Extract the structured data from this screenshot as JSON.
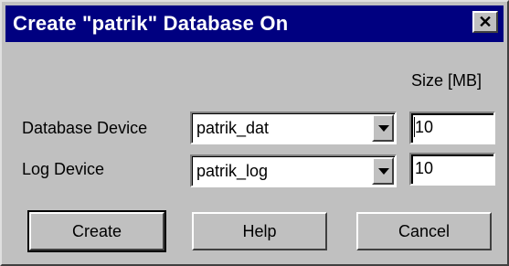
{
  "window": {
    "title": "Create \"patrik\" Database On",
    "close_glyph": "✕"
  },
  "size_header": "Size [MB]",
  "rows": [
    {
      "label": "Database Device",
      "device": "patrik_dat",
      "size": "10"
    },
    {
      "label": "Log Device",
      "device": "patrik_log",
      "size": "10"
    }
  ],
  "buttons": {
    "create": "Create",
    "help": "Help",
    "cancel": "Cancel"
  },
  "icons": {
    "close": "close-icon",
    "dropdown": "chevron-down-icon"
  },
  "colors": {
    "titlebar": "#000080",
    "face": "#c0c0c0"
  }
}
